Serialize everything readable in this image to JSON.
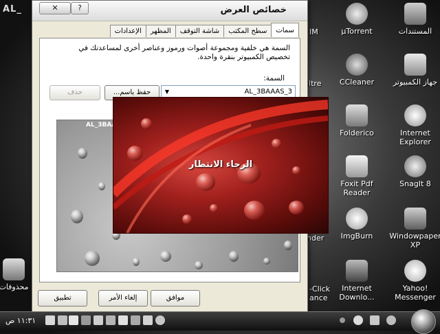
{
  "desktop": {
    "corner_text": "AL_",
    "icons": [
      {
        "label": "المستندات",
        "icon": "documents-icon",
        "color": "#8e8e8e"
      },
      {
        "label": "µTorrent",
        "icon": "utorrent-icon",
        "color": "#9a9a9a"
      },
      {
        "label": "جهاز الكمبيوتر",
        "icon": "computer-icon",
        "color": "#bdbdbd"
      },
      {
        "label": "CCleaner",
        "icon": "ccleaner-icon",
        "color": "#a8a8a8"
      },
      {
        "label": "Internet Explorer",
        "icon": "ie-icon",
        "color": "#cfcfcf"
      },
      {
        "label": "Folderico",
        "icon": "folderico-icon",
        "color": "#b0b0b0"
      },
      {
        "label": "SnagIt 8",
        "icon": "snagit-icon",
        "color": "#c2c2c2"
      },
      {
        "label": "Foxit Pdf Reader",
        "icon": "foxit-icon",
        "color": "#d0d0d0"
      },
      {
        "label": "Windowpaper XP",
        "icon": "windowpaper-icon",
        "color": "#9d9d9d"
      },
      {
        "label": "ImgBurn",
        "icon": "imgburn-icon",
        "color": "#b8b8b8"
      },
      {
        "label": "Yahoo! Messenger",
        "icon": "yahoo-icon",
        "color": "#d8d8d8"
      },
      {
        "label": "Internet Downlo...",
        "icon": "idm-icon",
        "color": "#8a8a8a"
      },
      {
        "label": "محذوفات",
        "icon": "recycle-bin-icon",
        "color": "#aaaaaa"
      }
    ],
    "partial_labels": [
      "IM",
      "iltre",
      "nder",
      "-Click",
      "ance"
    ]
  },
  "dialog": {
    "title": "خصائص العرض",
    "close_label": "✕",
    "help_label": "?",
    "tabs": [
      "سمات",
      "سطح المكتب",
      "شاشة التوقف",
      "المظهر",
      "الإعدادات"
    ],
    "active_tab": "سمات",
    "description": "السمة هي خلفية ومجموعة أصوات ورموز وعناصر أخرى لمساعدتك في تخصيص الكمبيوتر بنقرة واحدة.",
    "theme_label": "السمة:",
    "theme_value": "AL_3BAAAS_3",
    "save_as_label": "حفظ باسم...",
    "delete_label": "حذف",
    "preview_caption": "AL_3BAAAS XP",
    "ok_label": "موافق",
    "cancel_label": "إلغاء الأمر",
    "apply_label": "تطبيق"
  },
  "splash": {
    "text": "الرجاء الانتظار"
  },
  "taskbar": {
    "clock": "١١:٣١ ص"
  }
}
